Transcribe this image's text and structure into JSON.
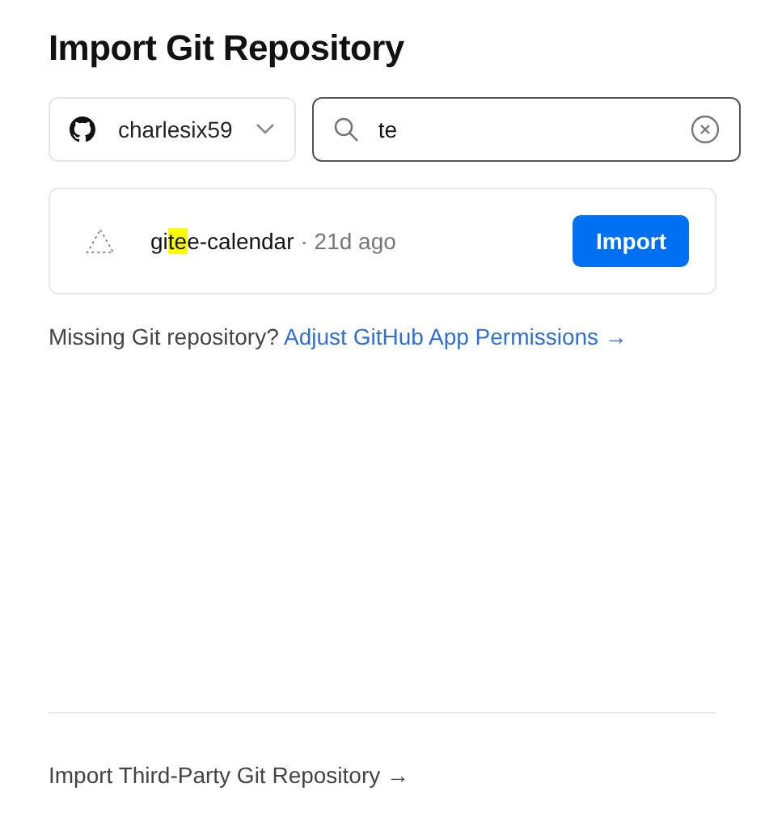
{
  "title": "Import Git Repository",
  "account_select": {
    "value": "charlesix59"
  },
  "search": {
    "value": "te"
  },
  "repositories": [
    {
      "name": "gitee-calendar",
      "age": "· 21d ago",
      "button": "Import"
    }
  ],
  "missing_note": {
    "text": "Missing Git repository?",
    "link": "Adjust GitHub App Permissions →"
  },
  "third_party_link": "Import Third-Party Git Repository →"
}
